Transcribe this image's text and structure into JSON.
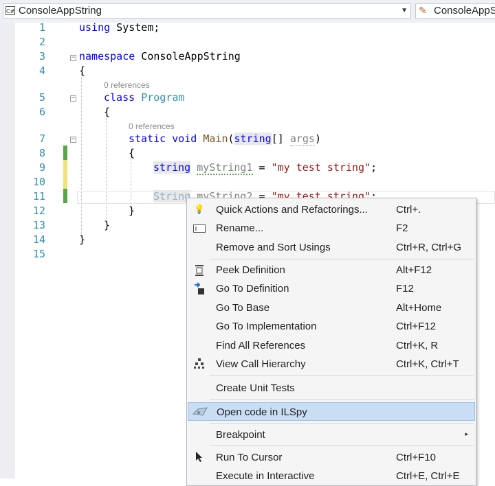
{
  "navbar": {
    "project_icon": "C#",
    "project": "ConsoleAppString",
    "class_combo": "ConsoleAppS",
    "dropdown_glyph": "▼"
  },
  "code": {
    "lines": [
      "1",
      "2",
      "3",
      "4",
      "5",
      "6",
      "7",
      "8",
      "9",
      "10",
      "11",
      "12",
      "13",
      "14",
      "15"
    ],
    "l1_kw": "using",
    "l1_rest": " System;",
    "l3_kw": "namespace",
    "l3_rest": " ConsoleAppString",
    "brace_open": "{",
    "brace_close": "}",
    "refs_class": "0 references",
    "refs_method": "0 references",
    "l5_kw": "class",
    "l5_type": "Program",
    "l7_kw1": "static",
    "l7_kw2": "void",
    "l7_method": "Main",
    "l7_paren_open": "(",
    "l7_kw3": "string",
    "l7_brackets": "[]",
    "l7_param": "args",
    "l7_paren_close": ")",
    "l9_kw": "string",
    "l9_var": "myString1",
    "l9_eq": " = ",
    "l9_str": "\"my test string\"",
    "l9_end": ";",
    "l11_type": "String",
    "l11_var": "myString2",
    "l11_eq": " = ",
    "l11_str": "\"my test string\"",
    "l11_end": ";",
    "collapse_glyph": "−"
  },
  "menu": {
    "items": [
      {
        "label": "Quick Actions and Refactorings...",
        "shortcut": "Ctrl+.",
        "icon": "lightbulb-icon"
      },
      {
        "label": "Rename...",
        "shortcut": "F2",
        "icon": "rename-icon"
      },
      {
        "label": "Remove and Sort Usings",
        "shortcut": "Ctrl+R, Ctrl+G"
      },
      {
        "label": "Peek Definition",
        "shortcut": "Alt+F12",
        "icon": "peek-icon"
      },
      {
        "label": "Go To Definition",
        "shortcut": "F12",
        "icon": "goto-definition-icon"
      },
      {
        "label": "Go To Base",
        "shortcut": "Alt+Home"
      },
      {
        "label": "Go To Implementation",
        "shortcut": "Ctrl+F12"
      },
      {
        "label": "Find All References",
        "shortcut": "Ctrl+K, R"
      },
      {
        "label": "View Call Hierarchy",
        "shortcut": "Ctrl+K, Ctrl+T",
        "icon": "call-hierarchy-icon"
      },
      {
        "label": "Create Unit Tests",
        "shortcut": ""
      },
      {
        "label": "Open code in ILSpy",
        "shortcut": "",
        "icon": "ilspy-icon"
      },
      {
        "label": "Breakpoint",
        "shortcut": "",
        "submenu": "▸"
      },
      {
        "label": "Run To Cursor",
        "shortcut": "Ctrl+F10",
        "icon": "cursor-icon"
      },
      {
        "label": "Execute in Interactive",
        "shortcut": "Ctrl+E, Ctrl+E"
      }
    ]
  },
  "colors": {
    "keyword": "#0000ff",
    "type": "#2b91af",
    "string": "#a31515",
    "line_number": "#2b91af",
    "change_saved": "#57a64a",
    "change_unsaved": "#efe27a",
    "menu_highlight": "#c9def5"
  }
}
